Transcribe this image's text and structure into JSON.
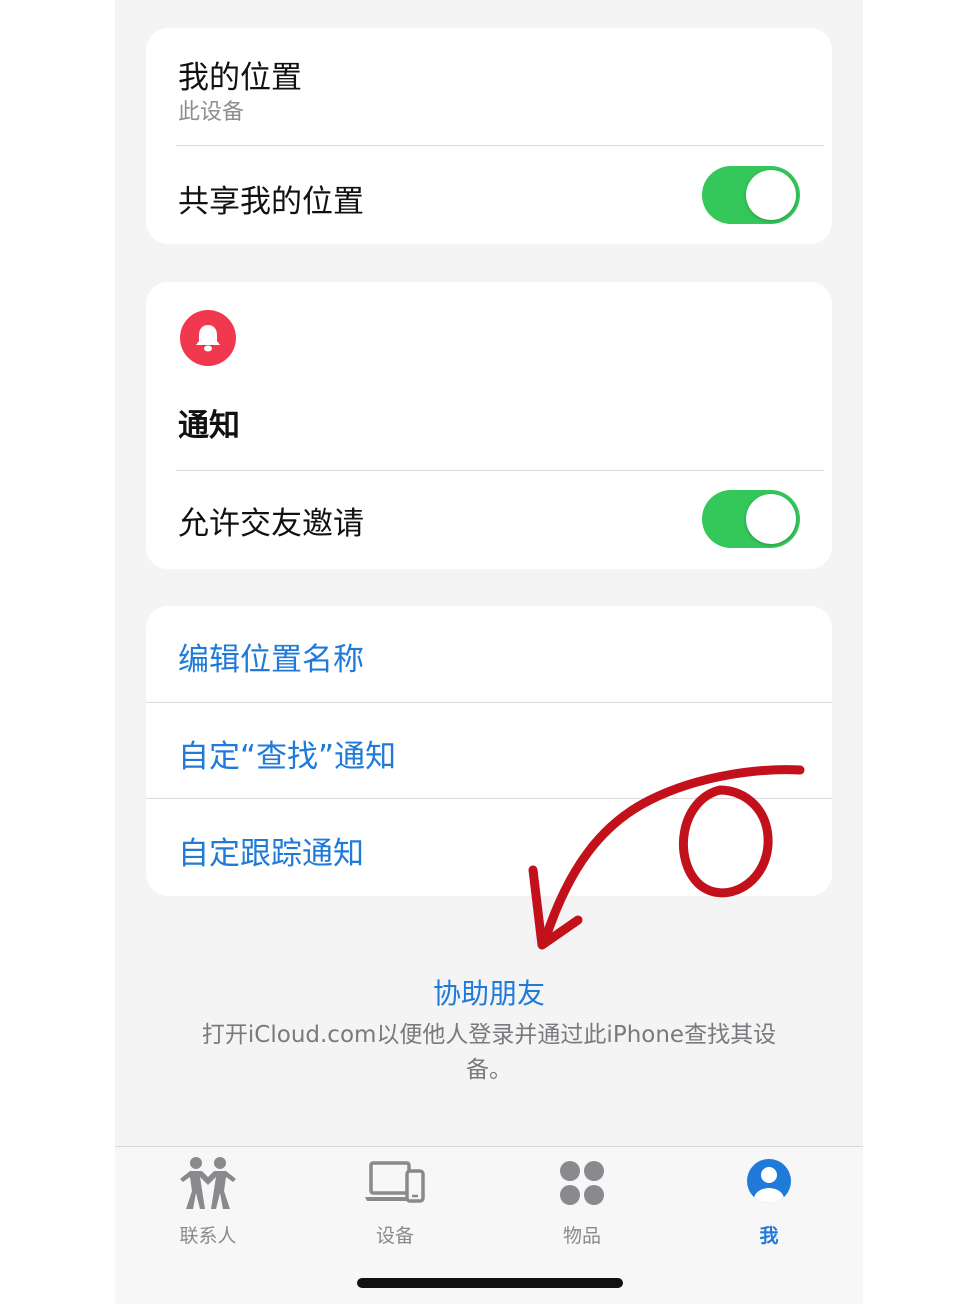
{
  "location_card": {
    "title": "我的位置",
    "subtitle": "此设备",
    "share_label": "共享我的位置",
    "share_enabled": true
  },
  "notifications_card": {
    "icon": "bell-icon",
    "title": "通知",
    "friend_invites_label": "允许交友邀请",
    "friend_invites_enabled": true
  },
  "actions_card": {
    "items": [
      {
        "label": "编辑位置名称"
      },
      {
        "label": "自定“查找”通知"
      },
      {
        "label": "自定跟踪通知"
      }
    ]
  },
  "help": {
    "link_label": "协助朋友",
    "description": "打开iCloud.com以便他人登录并通过此iPhone查找其设备。"
  },
  "tabbar": {
    "tabs": [
      {
        "label": "联系人",
        "icon": "people-icon",
        "active": false
      },
      {
        "label": "设备",
        "icon": "devices-icon",
        "active": false
      },
      {
        "label": "物品",
        "icon": "items-icon",
        "active": false
      },
      {
        "label": "我",
        "icon": "person-icon",
        "active": true
      }
    ]
  },
  "colors": {
    "accent": "#1f7ad9",
    "toggle_on": "#34c759",
    "bell_badge": "#f0384e",
    "annotation": "#c3111c"
  }
}
